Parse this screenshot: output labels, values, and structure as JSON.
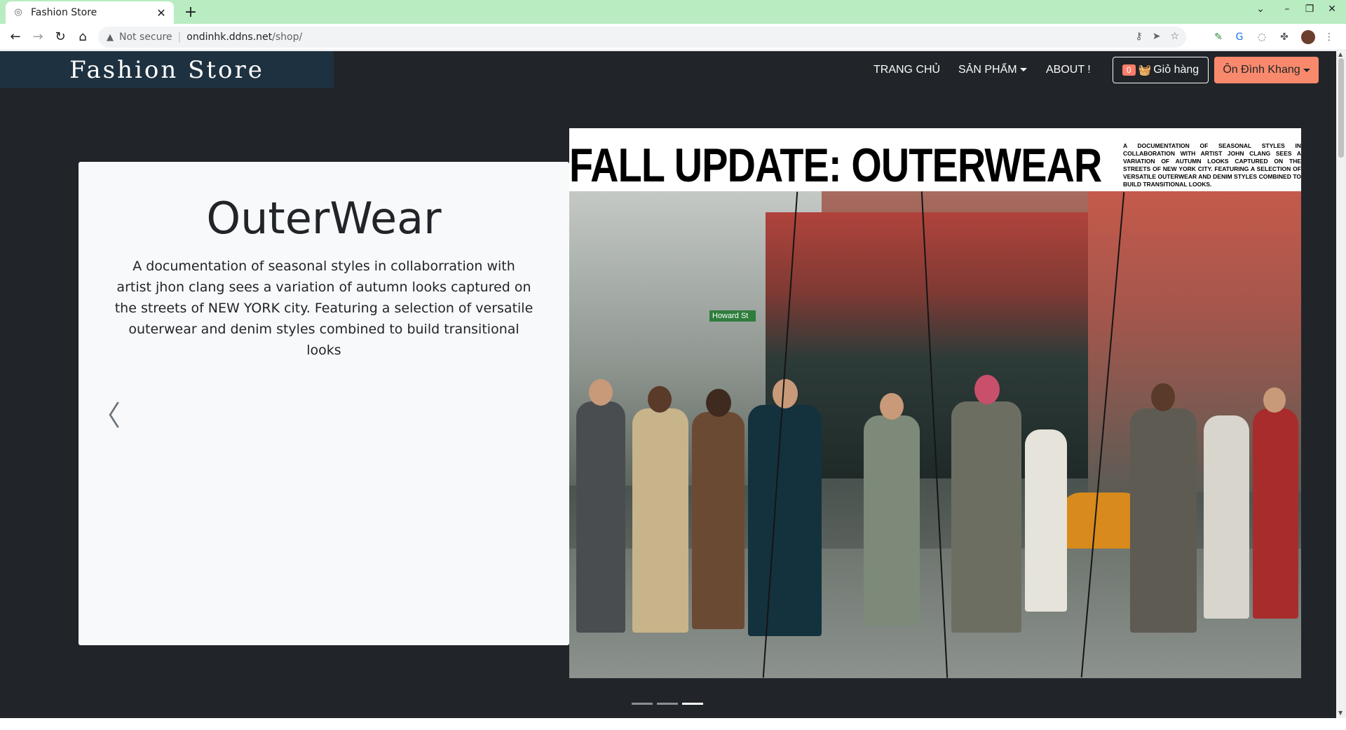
{
  "browser": {
    "tab_title": "Fashion Store",
    "new_tab": "+",
    "security_label": "Not secure",
    "url_host": "ondinhk.ddns.net",
    "url_path": "/shop/"
  },
  "site": {
    "brand": "Fashion Store",
    "nav": {
      "home": "TRANG CHỦ",
      "products": "SẢN PHẨM",
      "about": "ABOUT !"
    },
    "cart": {
      "count": "0",
      "label": "Giỏ hàng"
    },
    "user": "Ôn Đình Khang"
  },
  "carousel": {
    "heading": "OuterWear",
    "description": "A documentation of seasonal styles in collaborration with artist jhon clang sees a variation of autumn looks captured on the streets of NEW YORK city. Featuring a selection of versatile outerwear and denim styles combined to build transitional looks",
    "image_title": "FALL UPDATE: OUTERWEAR",
    "image_blurb": "A DOCUMENTATION OF SEASONAL STYLES IN COLLABORATION WITH ARTIST JOHN CLANG SEES A VARIATION OF AUTUMN LOOKS CAPTURED ON THE STREETS OF NEW YORK CITY. FEATURING A SELECTION OF VERSATILE OUTERWEAR AND DENIM STYLES COMBINED TO BUILD TRANSITIONAL LOOKS.",
    "street_sign": "Howard St",
    "slide_count": 3,
    "active_slide": 3
  },
  "colors": {
    "page_bg": "#212529",
    "brand_bg": "#1e3140",
    "user_button": "#f9896c",
    "cart_badge": "#fd7e6b",
    "tab_strip": "#b9ecc0"
  }
}
